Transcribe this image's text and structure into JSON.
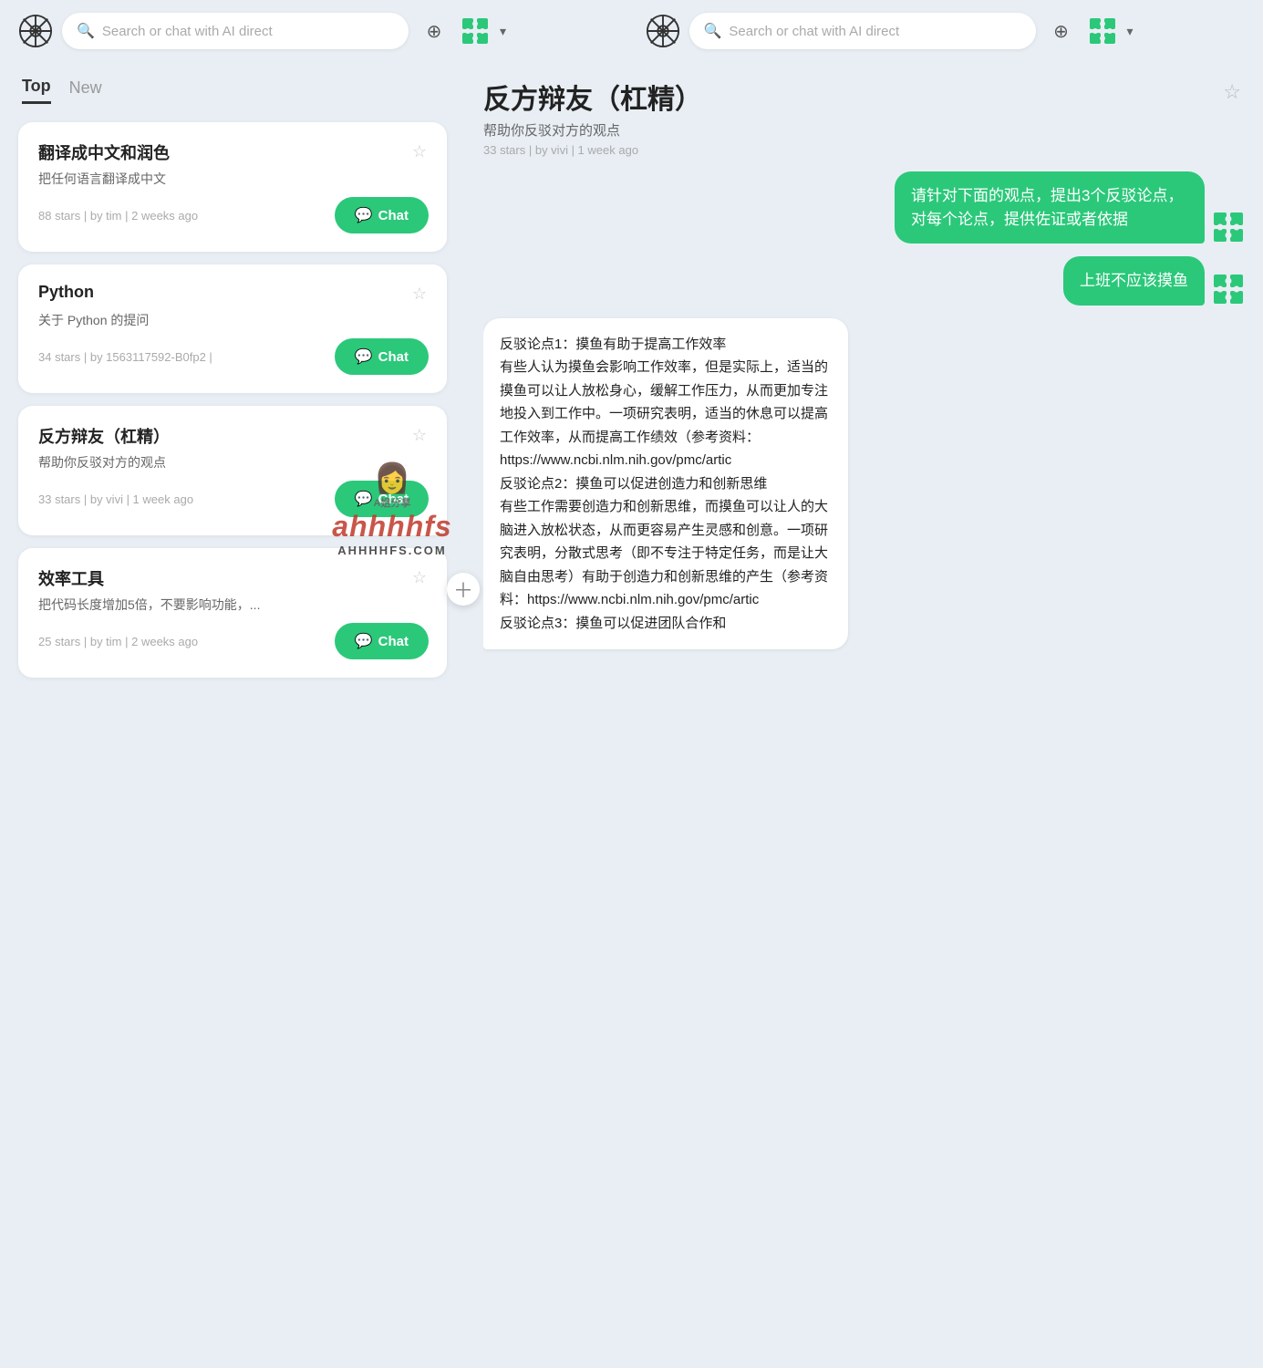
{
  "nav": {
    "search_placeholder_left": "Search or chat with AI direct",
    "search_placeholder_right": "Search or chat with AI direct",
    "add_button_label": "+",
    "chevron_label": "▾"
  },
  "left_panel": {
    "tabs": [
      {
        "id": "top",
        "label": "Top",
        "active": true
      },
      {
        "id": "new",
        "label": "New",
        "active": false
      }
    ],
    "cards": [
      {
        "id": "translate",
        "title": "翻译成中文和润色",
        "description": "把任何语言翻译成中文",
        "meta": "88 stars | by tim | 2 weeks ago",
        "chat_label": "Chat",
        "starred": false
      },
      {
        "id": "python",
        "title": "Python",
        "description": "关于 Python 的提问",
        "meta": "34 stars | by 1563117592-B0fp2 |",
        "chat_label": "Chat",
        "starred": false
      },
      {
        "id": "debate",
        "title": "反方辩友（杠精）",
        "description": "帮助你反驳对方的观点",
        "meta": "33 stars | by vivi | 1 week ago",
        "chat_label": "Chat",
        "starred": false
      },
      {
        "id": "efficiency",
        "title": "效率工具",
        "description": "把代码长度增加5倍，不要影响功能，...",
        "meta": "25 stars | by tim | 2 weeks ago",
        "chat_label": "Chat",
        "starred": false
      }
    ]
  },
  "right_panel": {
    "title": "反方辩友（杠精）",
    "subtitle": "帮助你反驳对方的观点",
    "meta": "33 stars | by vivi | 1 week ago",
    "starred": false,
    "messages": [
      {
        "id": "msg1",
        "role": "user",
        "text": "请针对下面的观点，提出3个反驳论点，对每个论点，提供佐证或者依据"
      },
      {
        "id": "msg2",
        "role": "user",
        "text": "上班不应该摸鱼"
      },
      {
        "id": "msg3",
        "role": "assistant",
        "text": "反驳论点1：摸鱼有助于提高工作效率\n有些人认为摸鱼会影响工作效率，但是实际上，适当的摸鱼可以让人放松身心，缓解工作压力，从而更加专注地投入到工作中。一项研究表明，适当的休息可以提高工作效率，从而提高工作绩效（参考资料：https://www.ncbi.nlm.nih.gov/pmc/artic\n反驳论点2：摸鱼可以促进创造力和创新思维\n有些工作需要创造力和创新思维，而摸鱼可以让人的大脑进入放松状态，从而更容易产生灵感和创意。一项研究表明，分散式思考（即不专注于特定任务，而是让大脑自由思考）有助于创造力和创新思维的产生（参考资料：https://www.ncbi.nlm.nih.gov/pmc/artic\n反驳论点3：摸鱼可以促进团队合作和"
      }
    ]
  },
  "watermark": {
    "emoji": "👩",
    "label": "A姐分享",
    "main": "ahhhhfs",
    "sub": "AHHHHFS.COM"
  }
}
